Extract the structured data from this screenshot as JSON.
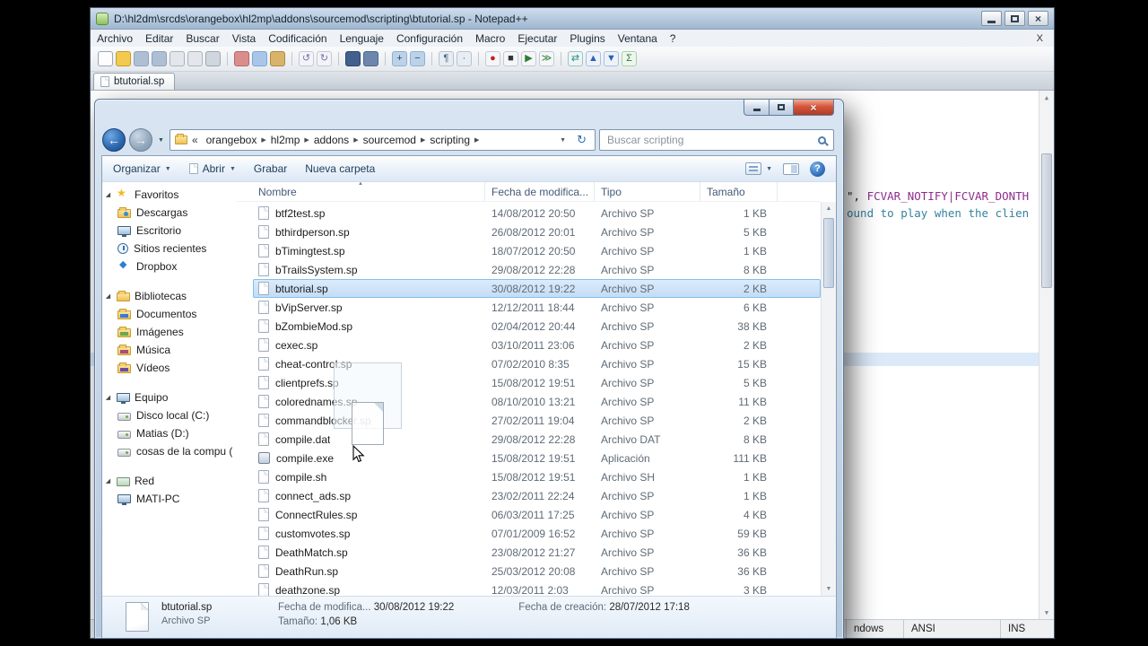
{
  "colors": {
    "selection_blue": "#c2dcf5",
    "keyword_purple": "#8f2c8f",
    "string_teal": "#35829e",
    "aero_glass": "#b4c8dd",
    "close_button_red": "#b13a24"
  },
  "notepadpp": {
    "window_title": "D:\\hl2dm\\srcds\\orangebox\\hl2mp\\addons\\sourcemod\\scripting\\btutorial.sp - Notepad++",
    "menu_items": [
      "Archivo",
      "Editar",
      "Buscar",
      "Vista",
      "Codificación",
      "Lenguaje",
      "Configuración",
      "Macro",
      "Ejecutar",
      "Plugins",
      "Ventana",
      "?"
    ],
    "menu_close_label": "X",
    "toolbar_icons": [
      {
        "name": "new-file-icon",
        "glyph": "",
        "bg": "#fdfdfd",
        "border": "#9aa7b5"
      },
      {
        "name": "open-folder-icon",
        "glyph": "",
        "bg": "#f3c94f",
        "border": "#c89a2a"
      },
      {
        "name": "save-icon",
        "glyph": "",
        "bg": "#aebfd4",
        "border": "#8fa3bc"
      },
      {
        "name": "save-all-icon",
        "glyph": "",
        "bg": "#aebfd4",
        "border": "#8fa3bc"
      },
      {
        "name": "close-file-icon",
        "glyph": "",
        "bg": "#e3e7ec",
        "border": "#aab4bf"
      },
      {
        "name": "close-all-icon",
        "glyph": "",
        "bg": "#e3e7ec",
        "border": "#aab4bf"
      },
      {
        "name": "print-icon",
        "glyph": "",
        "bg": "#cfd6dd",
        "border": "#9aa7b5"
      },
      {
        "sep": true
      },
      {
        "name": "cut-icon",
        "glyph": "",
        "bg": "#d98d8d",
        "border": "#b36a6a"
      },
      {
        "name": "copy-icon",
        "glyph": "",
        "bg": "#a9c6e8",
        "border": "#7fa6cf"
      },
      {
        "name": "paste-icon",
        "glyph": "",
        "bg": "#d9b36a",
        "border": "#b08a3f"
      },
      {
        "sep": true
      },
      {
        "name": "undo-icon",
        "glyph": "↺",
        "fg": "#7d6fae",
        "bg": "#f2f4f7",
        "border": "#c3cbd4"
      },
      {
        "name": "redo-icon",
        "glyph": "↻",
        "fg": "#7d6fae",
        "bg": "#f2f4f7",
        "border": "#c3cbd4"
      },
      {
        "sep": true
      },
      {
        "name": "find-icon",
        "glyph": "",
        "bg": "#41608e",
        "border": "#2c4668"
      },
      {
        "name": "replace-icon",
        "glyph": "",
        "bg": "#6d86ab",
        "border": "#4c6790"
      },
      {
        "sep": true
      },
      {
        "name": "zoom-in-icon",
        "glyph": "+",
        "fg": "#26486e",
        "bg": "#bcd2e8",
        "border": "#8fb0cf"
      },
      {
        "name": "zoom-out-icon",
        "glyph": "−",
        "fg": "#26486e",
        "bg": "#bcd2e8",
        "border": "#8fb0cf"
      },
      {
        "sep": true
      },
      {
        "name": "word-wrap-icon",
        "glyph": "¶",
        "fg": "#3f5e7e",
        "bg": "#e8edf3",
        "border": "#b7c3cf"
      },
      {
        "name": "show-symbols-icon",
        "glyph": "·",
        "fg": "#3f5e7e",
        "bg": "#e8edf3",
        "border": "#b7c3cf"
      },
      {
        "sep": true
      },
      {
        "name": "record-macro-icon",
        "glyph": "●",
        "fg": "#c41e1e",
        "bg": "#f4f6f8",
        "border": "#c3cbd4"
      },
      {
        "name": "stop-macro-icon",
        "glyph": "■",
        "fg": "#333333",
        "bg": "#f4f6f8",
        "border": "#c3cbd4"
      },
      {
        "name": "play-macro-icon",
        "glyph": "▶",
        "fg": "#2f7d33",
        "bg": "#f4f6f8",
        "border": "#c3cbd4"
      },
      {
        "name": "run-macro-multiple-icon",
        "glyph": "≫",
        "fg": "#2f7d33",
        "bg": "#f4f6f8",
        "border": "#c3cbd4"
      },
      {
        "sep": true
      },
      {
        "name": "compare-icon",
        "glyph": "⇄",
        "fg": "#1f8a8a",
        "bg": "#eef4f4",
        "border": "#9cc4c4"
      },
      {
        "name": "sort-ascending-icon",
        "glyph": "▲",
        "fg": "#2a62b8",
        "bg": "#eef2f8",
        "border": "#a9c0de"
      },
      {
        "name": "sort-descending-icon",
        "glyph": "▼",
        "fg": "#2a62b8",
        "bg": "#eef2f8",
        "border": "#a9c0de"
      },
      {
        "name": "sum-icon",
        "glyph": "Σ",
        "fg": "#2f7d33",
        "bg": "#eef6ee",
        "border": "#a9d0a9"
      }
    ],
    "tab_label": "btutorial.sp",
    "code": {
      "line1_prefix": "\", ",
      "line1_keyword": "FCVAR_NOTIFY|FCVAR_DONTH",
      "line2": "ound to play when the clien"
    },
    "status": {
      "eol": "ndows",
      "encoding": "ANSI",
      "insert_mode": "INS"
    }
  },
  "explorer": {
    "nav": {
      "truncation": "«",
      "breadcrumb": [
        "orangebox",
        "hl2mp",
        "addons",
        "sourcemod",
        "scripting"
      ],
      "search_text": "Buscar scripting"
    },
    "commandbar": {
      "organize": "Organizar",
      "open": "Abrir",
      "burn": "Grabar",
      "new_folder": "Nueva carpeta"
    },
    "sidebar": {
      "groups": [
        {
          "label": "Favoritos",
          "icon": "star",
          "items": [
            {
              "label": "Descargas",
              "icon": "folder-dl"
            },
            {
              "label": "Escritorio",
              "icon": "desktop"
            },
            {
              "label": "Sitios recientes",
              "icon": "clock"
            },
            {
              "label": "Dropbox",
              "icon": "dropbox"
            }
          ]
        },
        {
          "label": "Bibliotecas",
          "icon": "lib",
          "items": [
            {
              "label": "Documentos",
              "icon": "lib-doc"
            },
            {
              "label": "Imágenes",
              "icon": "lib-pic"
            },
            {
              "label": "Música",
              "icon": "lib-mus"
            },
            {
              "label": "Vídeos",
              "icon": "lib-vid"
            }
          ]
        },
        {
          "label": "Equipo",
          "icon": "pc",
          "items": [
            {
              "label": "Disco local (C:)",
              "icon": "drive"
            },
            {
              "label": "Matias (D:)",
              "icon": "drive"
            },
            {
              "label": "cosas de la compu (",
              "icon": "drive"
            }
          ]
        },
        {
          "label": "Red",
          "icon": "network",
          "items": [
            {
              "label": "MATI-PC",
              "icon": "pc"
            }
          ]
        }
      ]
    },
    "columns": [
      "Nombre",
      "Fecha de modifica...",
      "Tipo",
      "Tamaño"
    ],
    "files": [
      {
        "name": "btf2test.sp",
        "date": "14/08/2012 20:50",
        "type": "Archivo SP",
        "size": "1 KB"
      },
      {
        "name": "bthirdperson.sp",
        "date": "26/08/2012 20:01",
        "type": "Archivo SP",
        "size": "5 KB"
      },
      {
        "name": "bTimingtest.sp",
        "date": "18/07/2012 20:50",
        "type": "Archivo SP",
        "size": "1 KB"
      },
      {
        "name": "bTrailsSystem.sp",
        "date": "29/08/2012 22:28",
        "type": "Archivo SP",
        "size": "8 KB"
      },
      {
        "name": "btutorial.sp",
        "date": "30/08/2012 19:22",
        "type": "Archivo SP",
        "size": "2 KB",
        "selected": true
      },
      {
        "name": "bVipServer.sp",
        "date": "12/12/2011 18:44",
        "type": "Archivo SP",
        "size": "6 KB"
      },
      {
        "name": "bZombieMod.sp",
        "date": "02/04/2012 20:44",
        "type": "Archivo SP",
        "size": "38 KB"
      },
      {
        "name": "cexec.sp",
        "date": "03/10/2011 23:06",
        "type": "Archivo SP",
        "size": "2 KB"
      },
      {
        "name": "cheat-control.sp",
        "date": "07/02/2010 8:35",
        "type": "Archivo SP",
        "size": "15 KB"
      },
      {
        "name": "clientprefs.sp",
        "date": "15/08/2012 19:51",
        "type": "Archivo SP",
        "size": "5 KB"
      },
      {
        "name": "colorednames.sp",
        "date": "08/10/2010 13:21",
        "type": "Archivo SP",
        "size": "11 KB"
      },
      {
        "name": "commandblocker.sp",
        "date": "27/02/2011 19:04",
        "type": "Archivo SP",
        "size": "2 KB"
      },
      {
        "name": "compile.dat",
        "date": "29/08/2012 22:28",
        "type": "Archivo DAT",
        "size": "8 KB"
      },
      {
        "name": "compile.exe",
        "date": "15/08/2012 19:51",
        "type": "Aplicación",
        "size": "111 KB",
        "icon": "app"
      },
      {
        "name": "compile.sh",
        "date": "15/08/2012 19:51",
        "type": "Archivo SH",
        "size": "1 KB"
      },
      {
        "name": "connect_ads.sp",
        "date": "23/02/2011 22:24",
        "type": "Archivo SP",
        "size": "1 KB"
      },
      {
        "name": "ConnectRules.sp",
        "date": "06/03/2011 17:25",
        "type": "Archivo SP",
        "size": "4 KB"
      },
      {
        "name": "customvotes.sp",
        "date": "07/01/2009 16:52",
        "type": "Archivo SP",
        "size": "59 KB"
      },
      {
        "name": "DeathMatch.sp",
        "date": "23/08/2012 21:27",
        "type": "Archivo SP",
        "size": "36 KB"
      },
      {
        "name": "DeathRun.sp",
        "date": "25/03/2012 20:08",
        "type": "Archivo SP",
        "size": "36 KB"
      },
      {
        "name": "deathzone.sp",
        "date": "12/03/2011 2:03",
        "type": "Archivo SP",
        "size": "3 KB"
      }
    ],
    "details": {
      "name": "btutorial.sp",
      "type": "Archivo SP",
      "modified_label": "Fecha de modifica...",
      "modified": "30/08/2012 19:22",
      "created_label": "Fecha de creación:",
      "created": "28/07/2012 17:18",
      "size_label": "Tamaño:",
      "size": "1,06 KB"
    }
  }
}
